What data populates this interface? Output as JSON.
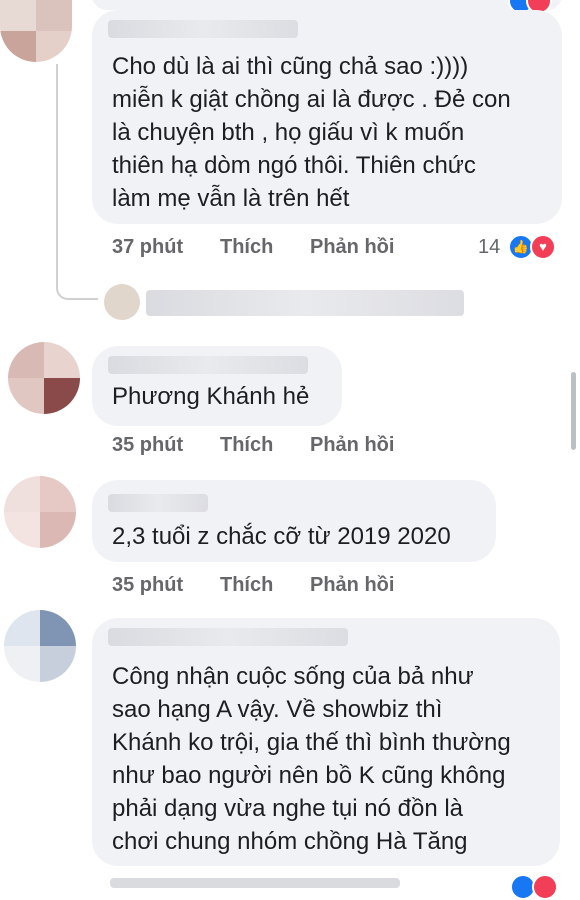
{
  "comments": [
    {
      "text": "Cho dù là ai thì cũng chả sao :))))\nmiễn k giật chồng ai là được . Đẻ con\nlà chuyện bth , họ giấu vì k muốn\nthiên hạ dòm ngó thôi. Thiên chức\nlàm mẹ vẫn là trên hết",
      "time": "37 phút",
      "like": "Thích",
      "reply": "Phản hồi",
      "reaction_count": "14"
    },
    {
      "text": "Phương Khánh hẻ",
      "time": "35 phút",
      "like": "Thích",
      "reply": "Phản hồi"
    },
    {
      "text": "2,3 tuổi z chắc cỡ từ 2019 2020",
      "time": "35 phút",
      "like": "Thích",
      "reply": "Phản hồi"
    },
    {
      "text": "Công nhận cuộc sống của bả như\nsao hạng A vậy. Về showbiz thì\nKhánh ko trội, gia thế thì bình thường\nnhư bao người nên bồ K cũng không\nphải dạng vừa nghe tụi nó đồn là\nchơi chung nhóm chồng Hà Tăng"
    }
  ],
  "reaction_icons": [
    "like-icon",
    "love-icon"
  ],
  "colors": {
    "like_blue": "#1877f2",
    "love_red": "#f33e58",
    "bubble": "#f0f2f5",
    "meta": "#65676b"
  }
}
